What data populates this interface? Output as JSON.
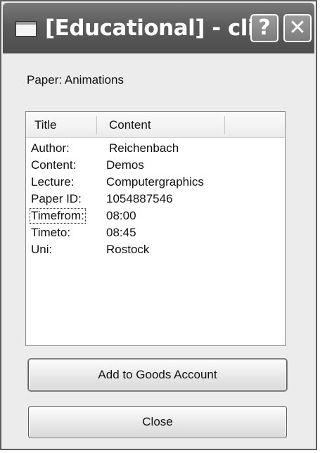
{
  "window": {
    "title": "[Educational] - cli...",
    "help_glyph": "?",
    "close_glyph": "✕"
  },
  "paper_label": "Paper: Animations",
  "listview": {
    "columns": [
      "Title",
      "Content"
    ],
    "rows": [
      {
        "key": "Author:",
        "value": "Reichenbach"
      },
      {
        "key": "Content:",
        "value": "Demos"
      },
      {
        "key": "Lecture:",
        "value": "Computergraphics"
      },
      {
        "key": "Paper ID:",
        "value": "1054887546"
      },
      {
        "key": "Timefrom:",
        "value": "08:00"
      },
      {
        "key": "Timeto:",
        "value": "08:45"
      },
      {
        "key": "Uni:",
        "value": "Rostock"
      }
    ],
    "focused_row": 4
  },
  "buttons": {
    "add": "Add to Goods Account",
    "close": "Close"
  }
}
